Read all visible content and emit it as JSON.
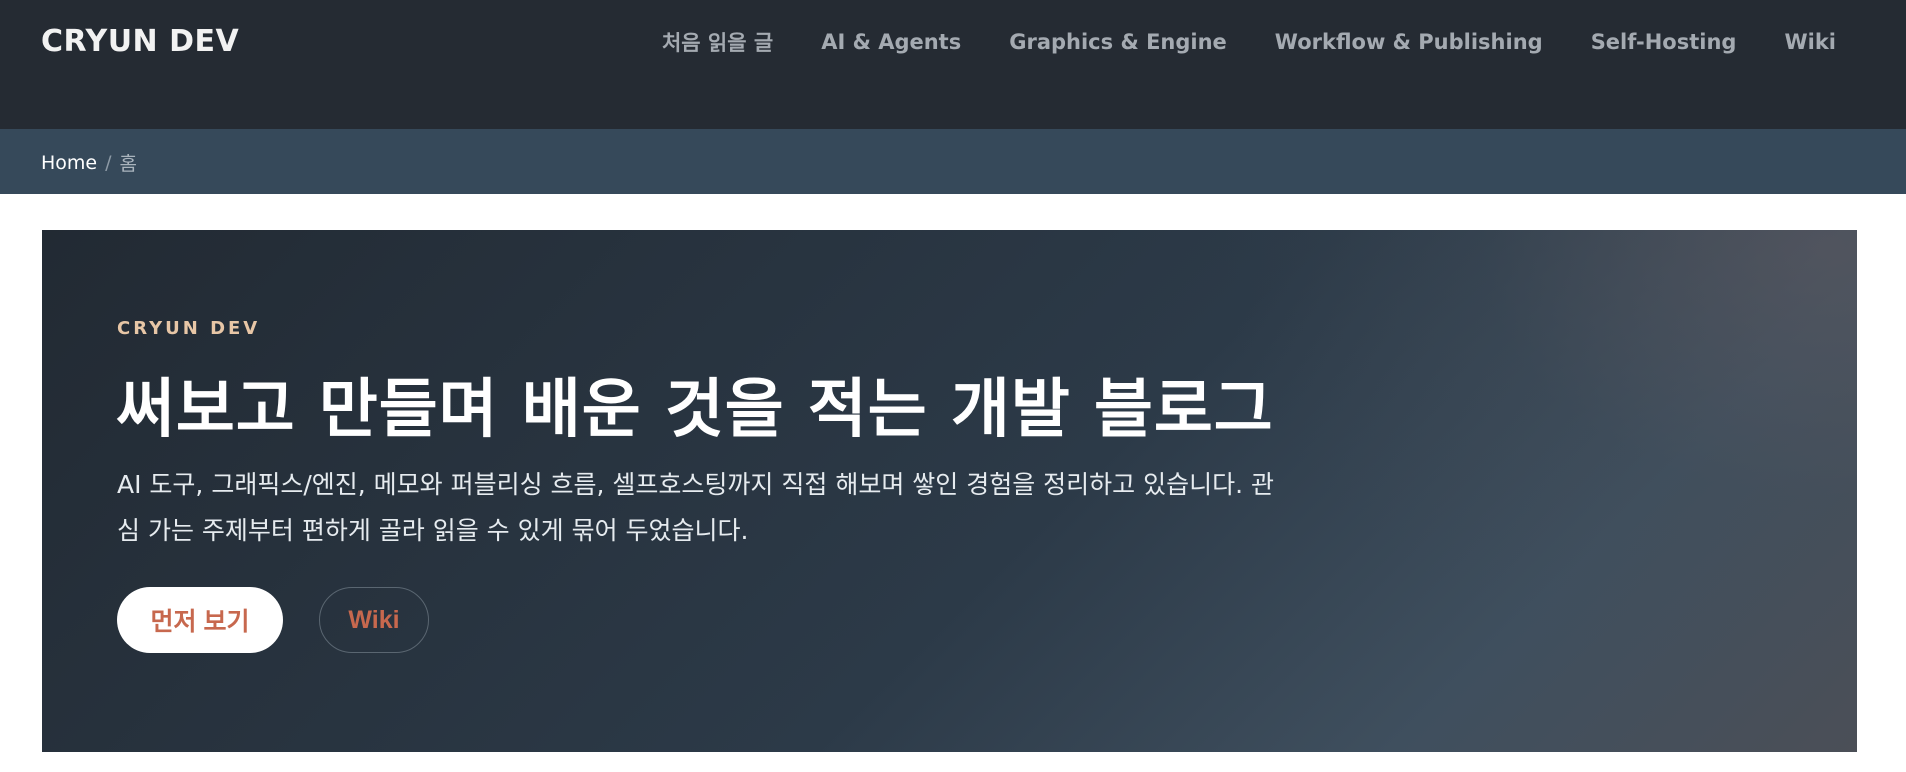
{
  "header": {
    "brand": "CRYUN DEV",
    "nav": [
      {
        "label": "처음 읽을 글"
      },
      {
        "label": "AI & Agents"
      },
      {
        "label": "Graphics & Engine"
      },
      {
        "label": "Workflow & Publishing"
      },
      {
        "label": "Self-Hosting"
      },
      {
        "label": "Wiki"
      }
    ]
  },
  "breadcrumb": {
    "home": "Home",
    "separator": "/",
    "current": "홈"
  },
  "hero": {
    "eyebrow": "CRYUN DEV",
    "title": "써보고 만들며 배운 것을 적는 개발 블로그",
    "description": "AI 도구, 그래픽스/엔진, 메모와 퍼블리싱 흐름, 셀프호스팅까지 직접 해보며 쌓인 경험을 정리하고 있습니다. 관심 가는 주제부터 편하게 골라 읽을 수 있게 묶어 두었습니다.",
    "primary_button": "먼저 보기",
    "secondary_button": "Wiki"
  },
  "colors": {
    "header_bg": "#252b33",
    "breadcrumb_bg": "#36495a",
    "accent": "#c7684e",
    "eyebrow": "#e7c6a6"
  }
}
